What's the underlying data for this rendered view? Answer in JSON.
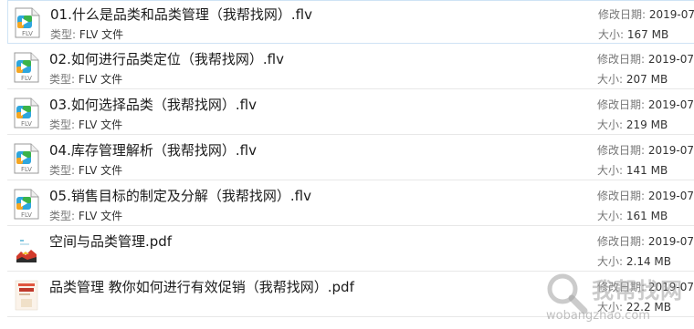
{
  "labels": {
    "type": "类型:",
    "date": "修改日期:",
    "size": "大小:"
  },
  "files": [
    {
      "name": "01.什么是品类和品类管理（我帮找网）.flv",
      "type": "FLV 文件",
      "date": "2019-07-",
      "size": "167 MB",
      "icon": "flv-video-file-icon",
      "selected": true
    },
    {
      "name": "02.如何进行品类定位（我帮找网）.flv",
      "type": "FLV 文件",
      "date": "2019-07-",
      "size": "207 MB",
      "icon": "flv-video-file-icon"
    },
    {
      "name": "03.如何选择品类（我帮找网）.flv",
      "type": "FLV 文件",
      "date": "2019-07-",
      "size": "219 MB",
      "icon": "flv-video-file-icon"
    },
    {
      "name": "04.库存管理解析（我帮找网）.flv",
      "type": "FLV 文件",
      "date": "2019-07-",
      "size": "141 MB",
      "icon": "flv-video-file-icon"
    },
    {
      "name": "05.销售目标的制定及分解（我帮找网）.flv",
      "type": "FLV 文件",
      "date": "2019-07-",
      "size": "161 MB",
      "icon": "flv-video-file-icon"
    },
    {
      "name": "空间与品类管理.pdf",
      "type": "",
      "date": "2019-07-",
      "size": "2.14 MB",
      "icon": "pdf-thumbnail-icon"
    },
    {
      "name": "品类管理 教你如何进行有效促销（我帮找网）.pdf",
      "type": "",
      "date": "2019-07-",
      "size": "22.2 MB",
      "icon": "pdf-book-thumbnail-icon"
    }
  ],
  "watermark": {
    "brand": "我帮找网",
    "url": "wobangzhao.com"
  }
}
